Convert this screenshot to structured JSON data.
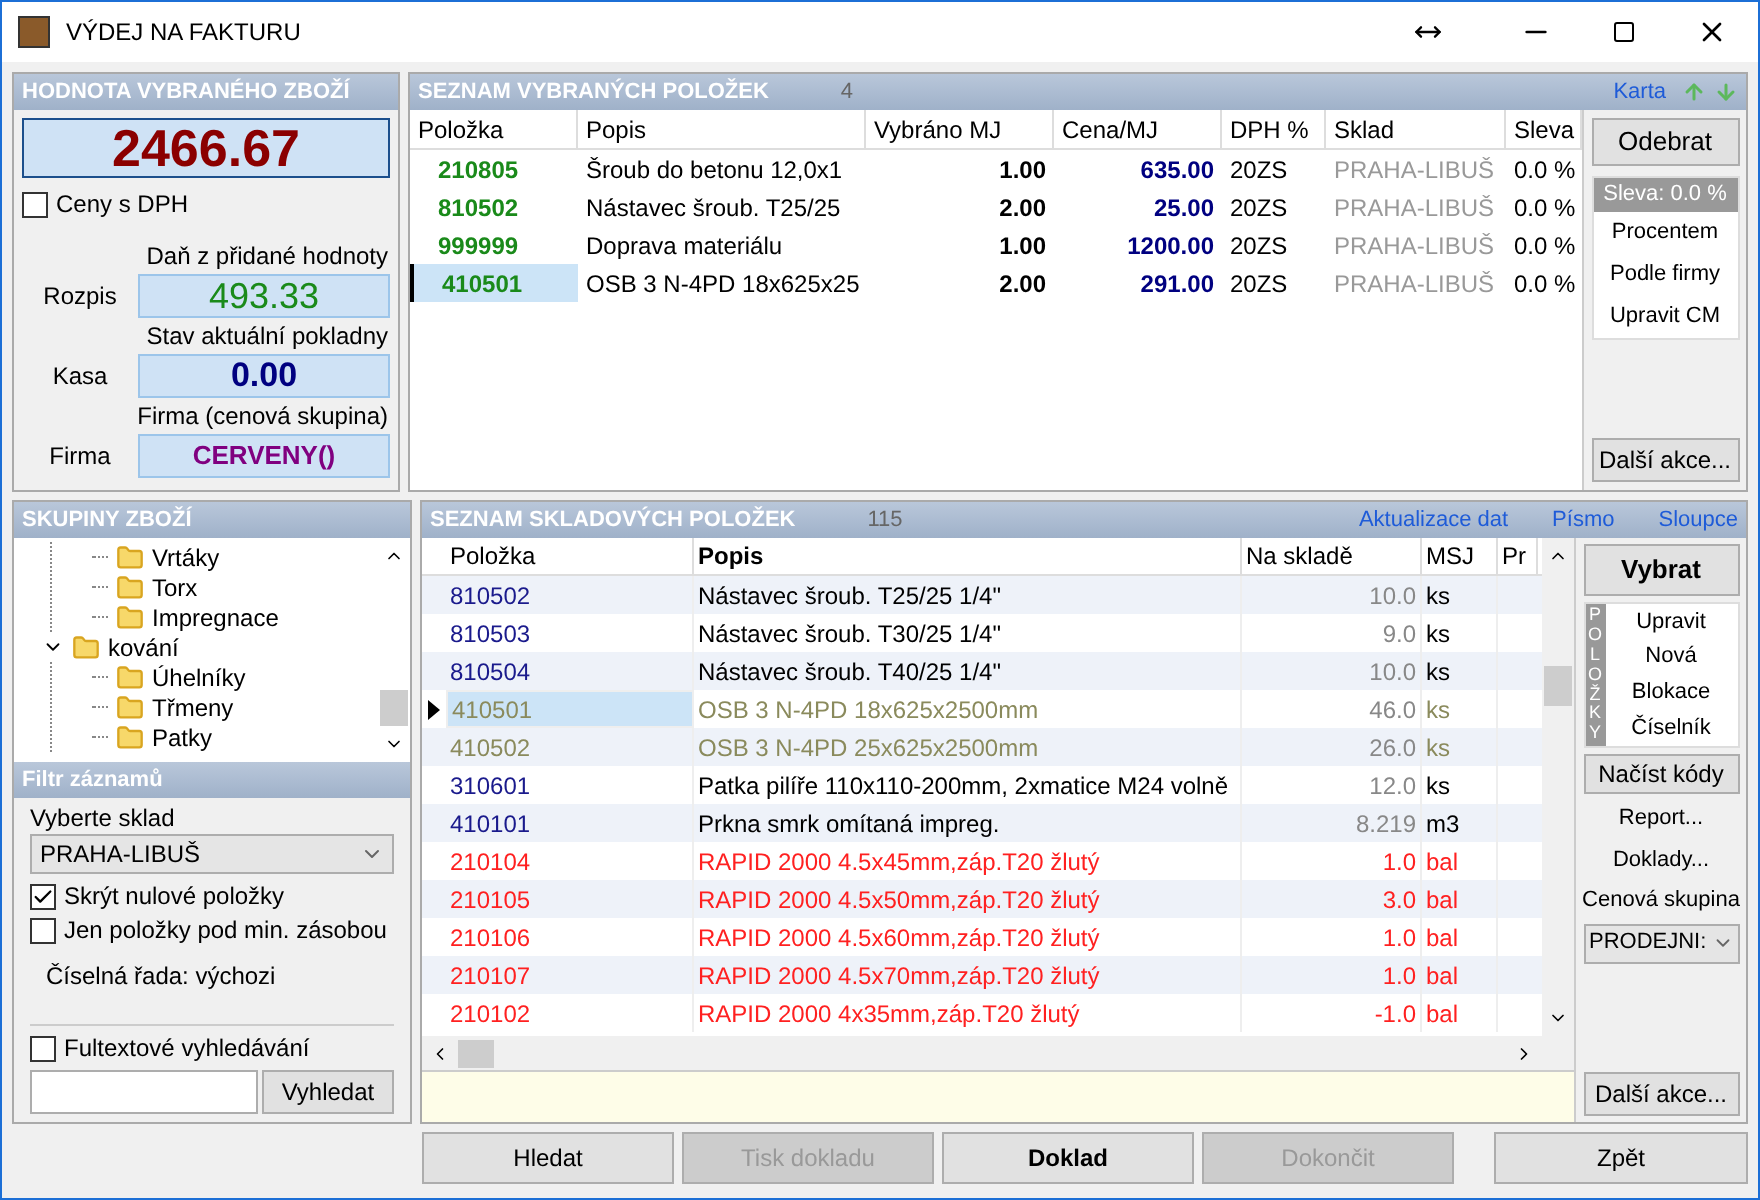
{
  "window": {
    "title": "VÝDEJ NA FAKTURU"
  },
  "value_panel": {
    "title": "HODNOTA VYBRANÉHO ZBOŽÍ",
    "total": "2466.67",
    "prices_with_vat": {
      "label": "Ceny s DPH",
      "checked": false
    },
    "fields": [
      {
        "caption": "Daň z přidané hodnoty",
        "label": "Rozpis",
        "value": "493.33",
        "color": "#1a8a1a"
      },
      {
        "caption": "Stav aktuální pokladny",
        "label": "Kasa",
        "value": "0.00",
        "color": "#000080"
      },
      {
        "caption": "Firma (cenová skupina)",
        "label": "Firma",
        "value": "CERVENY()",
        "color": "#800080"
      }
    ]
  },
  "selected_panel": {
    "title": "SEZNAM VYBRANÝCH POLOŽEK",
    "count": "4",
    "link": "Karta",
    "columns": [
      "Položka",
      "Popis",
      "Vybráno MJ",
      "Cena/MJ",
      "DPH %",
      "Sklad",
      "Sleva"
    ],
    "rows": [
      {
        "cells": [
          "210805",
          "Šroub do betonu 12,0x1",
          "1.00",
          "635.00",
          "20ZS",
          "PRAHA-LIBUŠ",
          "0.0 %"
        ],
        "selected": false
      },
      {
        "cells": [
          "810502",
          "Nástavec šroub. T25/25",
          "2.00",
          "25.00",
          "20ZS",
          "PRAHA-LIBUŠ",
          "0.0 %"
        ],
        "selected": false
      },
      {
        "cells": [
          "999999",
          "Doprava materiálu",
          "1.00",
          "1200.00",
          "20ZS",
          "PRAHA-LIBUŠ",
          "0.0 %"
        ],
        "selected": false
      },
      {
        "cells": [
          "410501",
          "OSB 3 N-4PD 18x625x25",
          "2.00",
          "291.00",
          "20ZS",
          "PRAHA-LIBUŠ",
          "0.0 %"
        ],
        "selected": true
      }
    ],
    "remove_button": "Odebrat",
    "discount_label": "Sleva: 0.0 %",
    "actions": [
      "Procentem",
      "Podle firmy",
      "Upravit CM"
    ],
    "more_button": "Další akce..."
  },
  "groups_panel": {
    "title": "SKUPINY ZBOŽÍ",
    "tree": [
      {
        "children": [
          {
            "label": "Vrtáky"
          },
          {
            "label": "Torx"
          },
          {
            "label": "Impregnace"
          }
        ]
      },
      {
        "label": "kování",
        "expanded": true,
        "children": [
          {
            "label": "Úhelníky"
          },
          {
            "label": "Třmeny"
          },
          {
            "label": "Patky"
          }
        ]
      }
    ]
  },
  "filter_panel": {
    "title": "Filtr záznamů",
    "warehouse_label": "Vyberte sklad",
    "warehouse": "PRAHA-LIBUŠ",
    "options": [
      {
        "label": "Skrýt nulové položky",
        "checked": true
      },
      {
        "label": "Jen položky pod min. zásobou",
        "checked": false
      }
    ],
    "series": "Číselná řada: výchozi",
    "fulltext": {
      "label": "Fultextové vyhledávání",
      "checked": false
    },
    "search_button": "Vyhledat"
  },
  "stock_panel": {
    "title": "SEZNAM SKLADOVÝCH POLOŽEK",
    "count": "115",
    "links": [
      "Aktualizace dat",
      "Písmo",
      "Sloupce"
    ],
    "columns": [
      "Položka",
      "Popis",
      "Na skladě",
      "MSJ",
      "Pr"
    ],
    "rows": [
      {
        "cells": [
          "810502",
          "Nástavec šroub. T25/25 1/4\"",
          "10.0",
          "ks"
        ],
        "color": "#1a1a8c",
        "selected": false
      },
      {
        "cells": [
          "810503",
          "Nástavec šroub. T30/25 1/4\"",
          "9.0",
          "ks"
        ],
        "color": "#1a1a8c",
        "selected": false
      },
      {
        "cells": [
          "810504",
          "Nástavec šroub. T40/25 1/4\"",
          "10.0",
          "ks"
        ],
        "color": "#1a1a8c",
        "selected": false
      },
      {
        "cells": [
          "410501",
          "OSB 3 N-4PD 18x625x2500mm",
          "46.0",
          "ks"
        ],
        "color": "#8a8a5c",
        "selected": true
      },
      {
        "cells": [
          "410502",
          "OSB 3 N-4PD 25x625x2500mm",
          "26.0",
          "ks"
        ],
        "color": "#8a8a5c",
        "selected": false
      },
      {
        "cells": [
          "310601",
          "Patka pilíře 110x110-200mm, 2xmatice M24 volně",
          "12.0",
          "ks"
        ],
        "color": "#1a1a8c",
        "selected": false
      },
      {
        "cells": [
          "410101",
          "Prkna smrk omítaná impreg.",
          "8.219",
          "m3"
        ],
        "color": "#1a1a8c",
        "selected": false
      },
      {
        "cells": [
          "210104",
          "RAPID 2000 4.5x45mm,záp.T20 žlutý",
          "1.0",
          "bal"
        ],
        "color": "#ff2020",
        "selected": false
      },
      {
        "cells": [
          "210105",
          "RAPID 2000 4.5x50mm,záp.T20 žlutý",
          "3.0",
          "bal"
        ],
        "color": "#ff2020",
        "selected": false
      },
      {
        "cells": [
          "210106",
          "RAPID 2000 4.5x60mm,záp.T20 žlutý",
          "1.0",
          "bal"
        ],
        "color": "#ff2020",
        "selected": false
      },
      {
        "cells": [
          "210107",
          "RAPID 2000 4.5x70mm,záp.T20 žlutý",
          "1.0",
          "bal"
        ],
        "color": "#ff2020",
        "selected": false
      },
      {
        "cells": [
          "210102",
          "RAPID 2000 4x35mm,záp.T20 žlutý",
          "-1.0",
          "bal"
        ],
        "color": "#ff2020",
        "selected": false
      }
    ],
    "select_button": "Vybrat",
    "vertical_label": "POLOŽKY",
    "item_actions": [
      "Upravit",
      "Nová",
      "Blokace",
      "Číselník"
    ],
    "load_codes_button": "Načíst kódy",
    "links2": [
      "Report...",
      "Doklady..."
    ],
    "price_group_label": "Cenová skupina",
    "price_group": "PRODEJNI:",
    "more_button": "Další akce..."
  },
  "footer_buttons": [
    {
      "label": "Hledat",
      "disabled": false,
      "bold": false
    },
    {
      "label": "Tisk dokladu",
      "disabled": true,
      "bold": false
    },
    {
      "label": "Doklad",
      "disabled": false,
      "bold": true
    },
    {
      "label": "Dokončit",
      "disabled": true,
      "bold": false
    },
    {
      "label": "Zpět",
      "disabled": false,
      "bold": false
    }
  ]
}
